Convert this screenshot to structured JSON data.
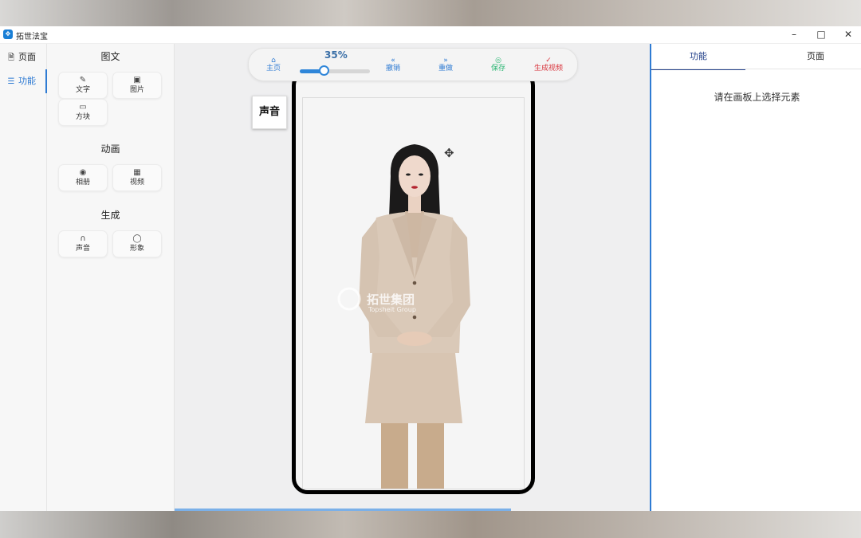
{
  "window": {
    "title": "拓世法宝",
    "icon_glyph": "✥"
  },
  "nav": {
    "items": [
      {
        "label": "页面",
        "icon": "page-icon"
      },
      {
        "label": "功能",
        "icon": "sliders-icon",
        "active": true
      }
    ]
  },
  "tools": {
    "sections": [
      {
        "title": "图文",
        "items": [
          {
            "label": "文字",
            "icon": "edit-icon"
          },
          {
            "label": "图片",
            "icon": "image-icon"
          },
          {
            "label": "方块",
            "icon": "block-icon"
          }
        ]
      },
      {
        "title": "动画",
        "items": [
          {
            "label": "相册",
            "icon": "camera-icon"
          },
          {
            "label": "视频",
            "icon": "film-icon"
          }
        ]
      },
      {
        "title": "生成",
        "items": [
          {
            "label": "声音",
            "icon": "headphones-icon"
          },
          {
            "label": "形象",
            "icon": "user-icon"
          }
        ]
      }
    ]
  },
  "toolbar": {
    "home": "主页",
    "zoom_label": "35%",
    "zoom_value": 0.35,
    "undo": "撤销",
    "redo": "重做",
    "save": "保存",
    "generate": "生成视频",
    "colors": {
      "accent": "#2f86d9",
      "save": "#2bb673",
      "generate": "#d9363e"
    }
  },
  "canvas": {
    "sound_chip": "声音",
    "watermark": "拓世集团",
    "watermark_en": "Topsheit Group"
  },
  "right_panel": {
    "tabs": [
      "功能",
      "页面"
    ],
    "hint": "请在画板上选择元素"
  }
}
